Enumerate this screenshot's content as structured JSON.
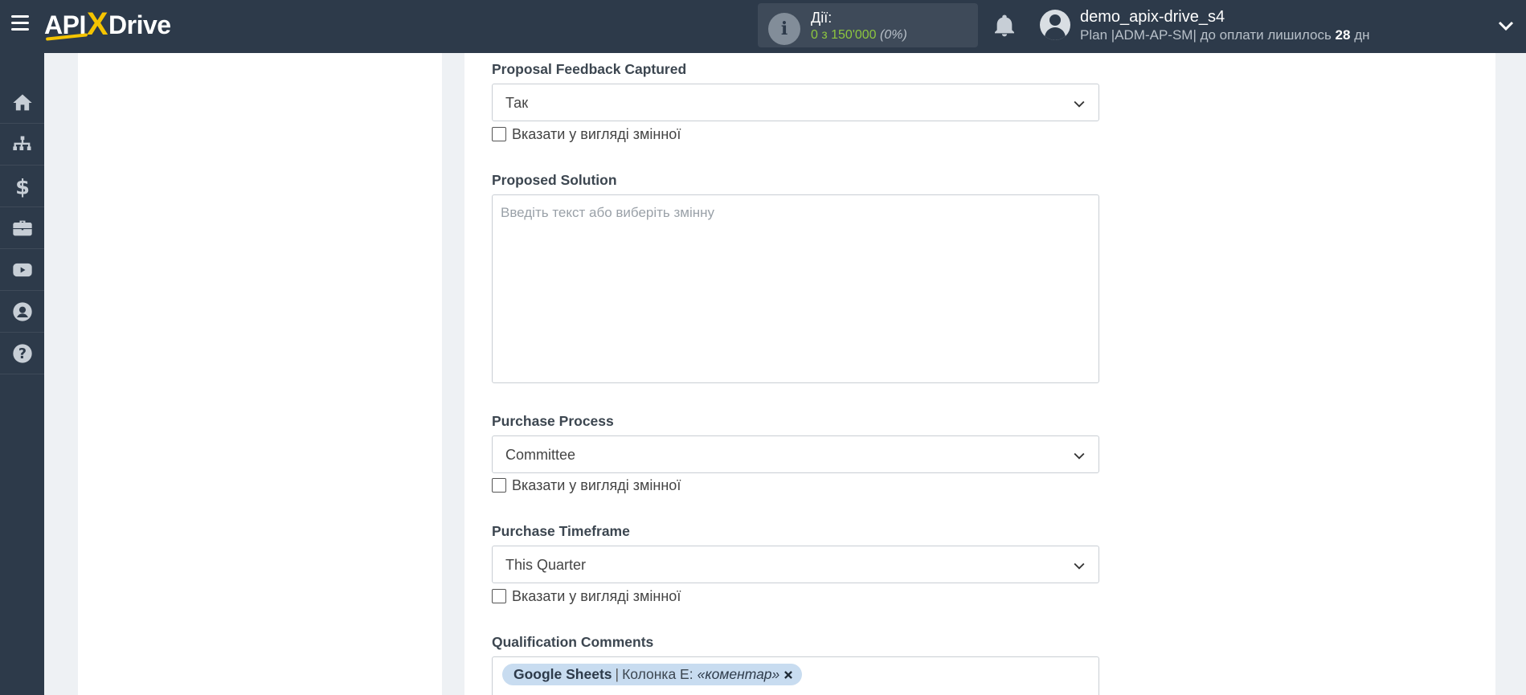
{
  "header": {
    "logo_pre": "API",
    "logo_x": "X",
    "logo_post": "Drive",
    "actions_label": "Дії:",
    "actions_value": "0 з 150'000",
    "actions_pct": "(0%)",
    "username": "demo_apix-drive_s4",
    "plan_prefix": "Plan |ADM-AP-SM| до оплати лишилось ",
    "plan_days": "28",
    "plan_suffix": " дн",
    "accent_color": "#8dc63f",
    "brand_color": "#f5c400"
  },
  "sidebar": {
    "items": [
      {
        "icon": "home-icon"
      },
      {
        "icon": "sitemap-icon"
      },
      {
        "icon": "dollar-icon"
      },
      {
        "icon": "briefcase-icon"
      },
      {
        "icon": "youtube-icon"
      },
      {
        "icon": "user-icon"
      },
      {
        "icon": "help-icon"
      }
    ]
  },
  "form": {
    "proposal_feedback": {
      "label": "Proposal Feedback Captured",
      "value": "Так",
      "checkbox_label": "Вказати у вигляді змінної"
    },
    "proposed_solution": {
      "label": "Proposed Solution",
      "placeholder": "Введіть текст або виберіть змінну"
    },
    "purchase_process": {
      "label": "Purchase Process",
      "value": "Committee",
      "checkbox_label": "Вказати у вигляді змінної"
    },
    "purchase_timeframe": {
      "label": "Purchase Timeframe",
      "value": "This Quarter",
      "checkbox_label": "Вказати у вигляді змінної"
    },
    "qualification_comments": {
      "label": "Qualification Comments",
      "tag_source": "Google Sheets",
      "tag_sep": "|",
      "tag_column": "Колонка E:",
      "tag_value": "«коментар»"
    }
  }
}
